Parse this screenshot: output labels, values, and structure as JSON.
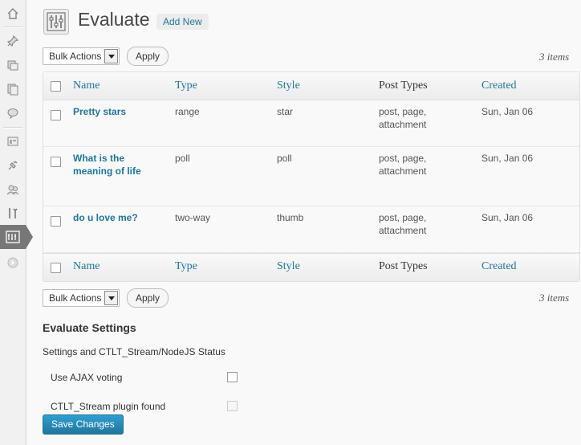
{
  "sidebar": {
    "items": [
      {
        "icon": "dashboard-icon"
      },
      {
        "icon": "posts-pin-icon"
      },
      {
        "icon": "media-icon"
      },
      {
        "icon": "pages-icon"
      },
      {
        "icon": "comments-icon"
      },
      {
        "icon": "appearance-icon"
      },
      {
        "icon": "plugins-icon"
      },
      {
        "icon": "users-icon"
      },
      {
        "icon": "tools-icon"
      },
      {
        "icon": "evaluate-icon",
        "active": true
      },
      {
        "icon": "collapse-menu-icon"
      }
    ]
  },
  "header": {
    "title": "Evaluate",
    "add_new": "Add New"
  },
  "top_actions": {
    "bulk_label": "Bulk Actions",
    "apply": "Apply",
    "count": "3 items"
  },
  "bottom_actions": {
    "bulk_label": "Bulk Actions",
    "apply": "Apply",
    "count": "3 items"
  },
  "table": {
    "columns": [
      "Name",
      "Type",
      "Style",
      "Post Types",
      "Created"
    ],
    "rows": [
      {
        "name": "Pretty stars",
        "type": "range",
        "style": "star",
        "post_types_1": "post, page,",
        "post_types_2": "attachment",
        "created": "Sun, Jan 06"
      },
      {
        "name_1": "What is the",
        "name_2": "meaning of life",
        "type": "poll",
        "style": "poll",
        "post_types_1": "post, page,",
        "post_types_2": "attachment",
        "created": "Sun, Jan 06"
      },
      {
        "name": "do u love me?",
        "type": "two-way",
        "style": "thumb",
        "post_types_1": "post, page,",
        "post_types_2": "attachment",
        "created": "Sun, Jan 06"
      }
    ]
  },
  "settings": {
    "heading": "Evaluate Settings",
    "description": "Settings and CTLT_Stream/NodeJS Status",
    "options": [
      {
        "label": "Use AJAX voting",
        "checked": false,
        "disabled": false
      },
      {
        "label": "CTLT_Stream plugin found",
        "checked": false,
        "disabled": true
      }
    ],
    "save": "Save Changes"
  },
  "colors": {
    "link": "#21759b",
    "primary_button": "#21759b",
    "active_menu": "#777777"
  }
}
